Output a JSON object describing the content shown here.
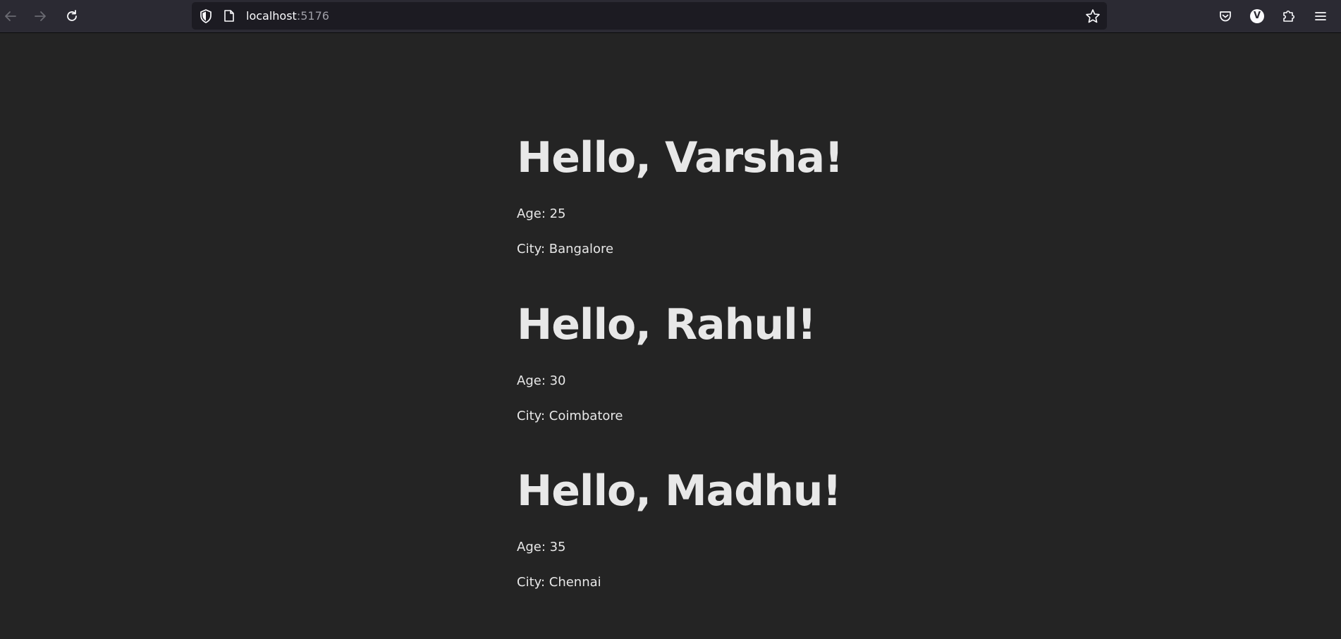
{
  "browser": {
    "url_host": "localhost",
    "url_port": ":5176",
    "back_icon": "back-arrow-icon",
    "forward_icon": "forward-arrow-icon",
    "reload_icon": "reload-icon",
    "shield_icon": "shield-icon",
    "page_icon": "page-icon",
    "bookmark_icon": "star-icon",
    "pocket_icon": "pocket-icon",
    "account_initial": "V",
    "extensions_icon": "puzzle-icon",
    "menu_icon": "hamburger-menu-icon"
  },
  "people": [
    {
      "greeting": "Hello, Varsha!",
      "age": "Age: 25",
      "city": "City: Bangalore"
    },
    {
      "greeting": "Hello, Rahul!",
      "age": "Age: 30",
      "city": "City: Coimbatore"
    },
    {
      "greeting": "Hello, Madhu!",
      "age": "Age: 35",
      "city": "City: Chennai"
    }
  ],
  "colors": {
    "background": "#242424",
    "toolbar": "#2b2a33",
    "urlbar": "#1c1b22",
    "text": "#e8e8e8"
  }
}
